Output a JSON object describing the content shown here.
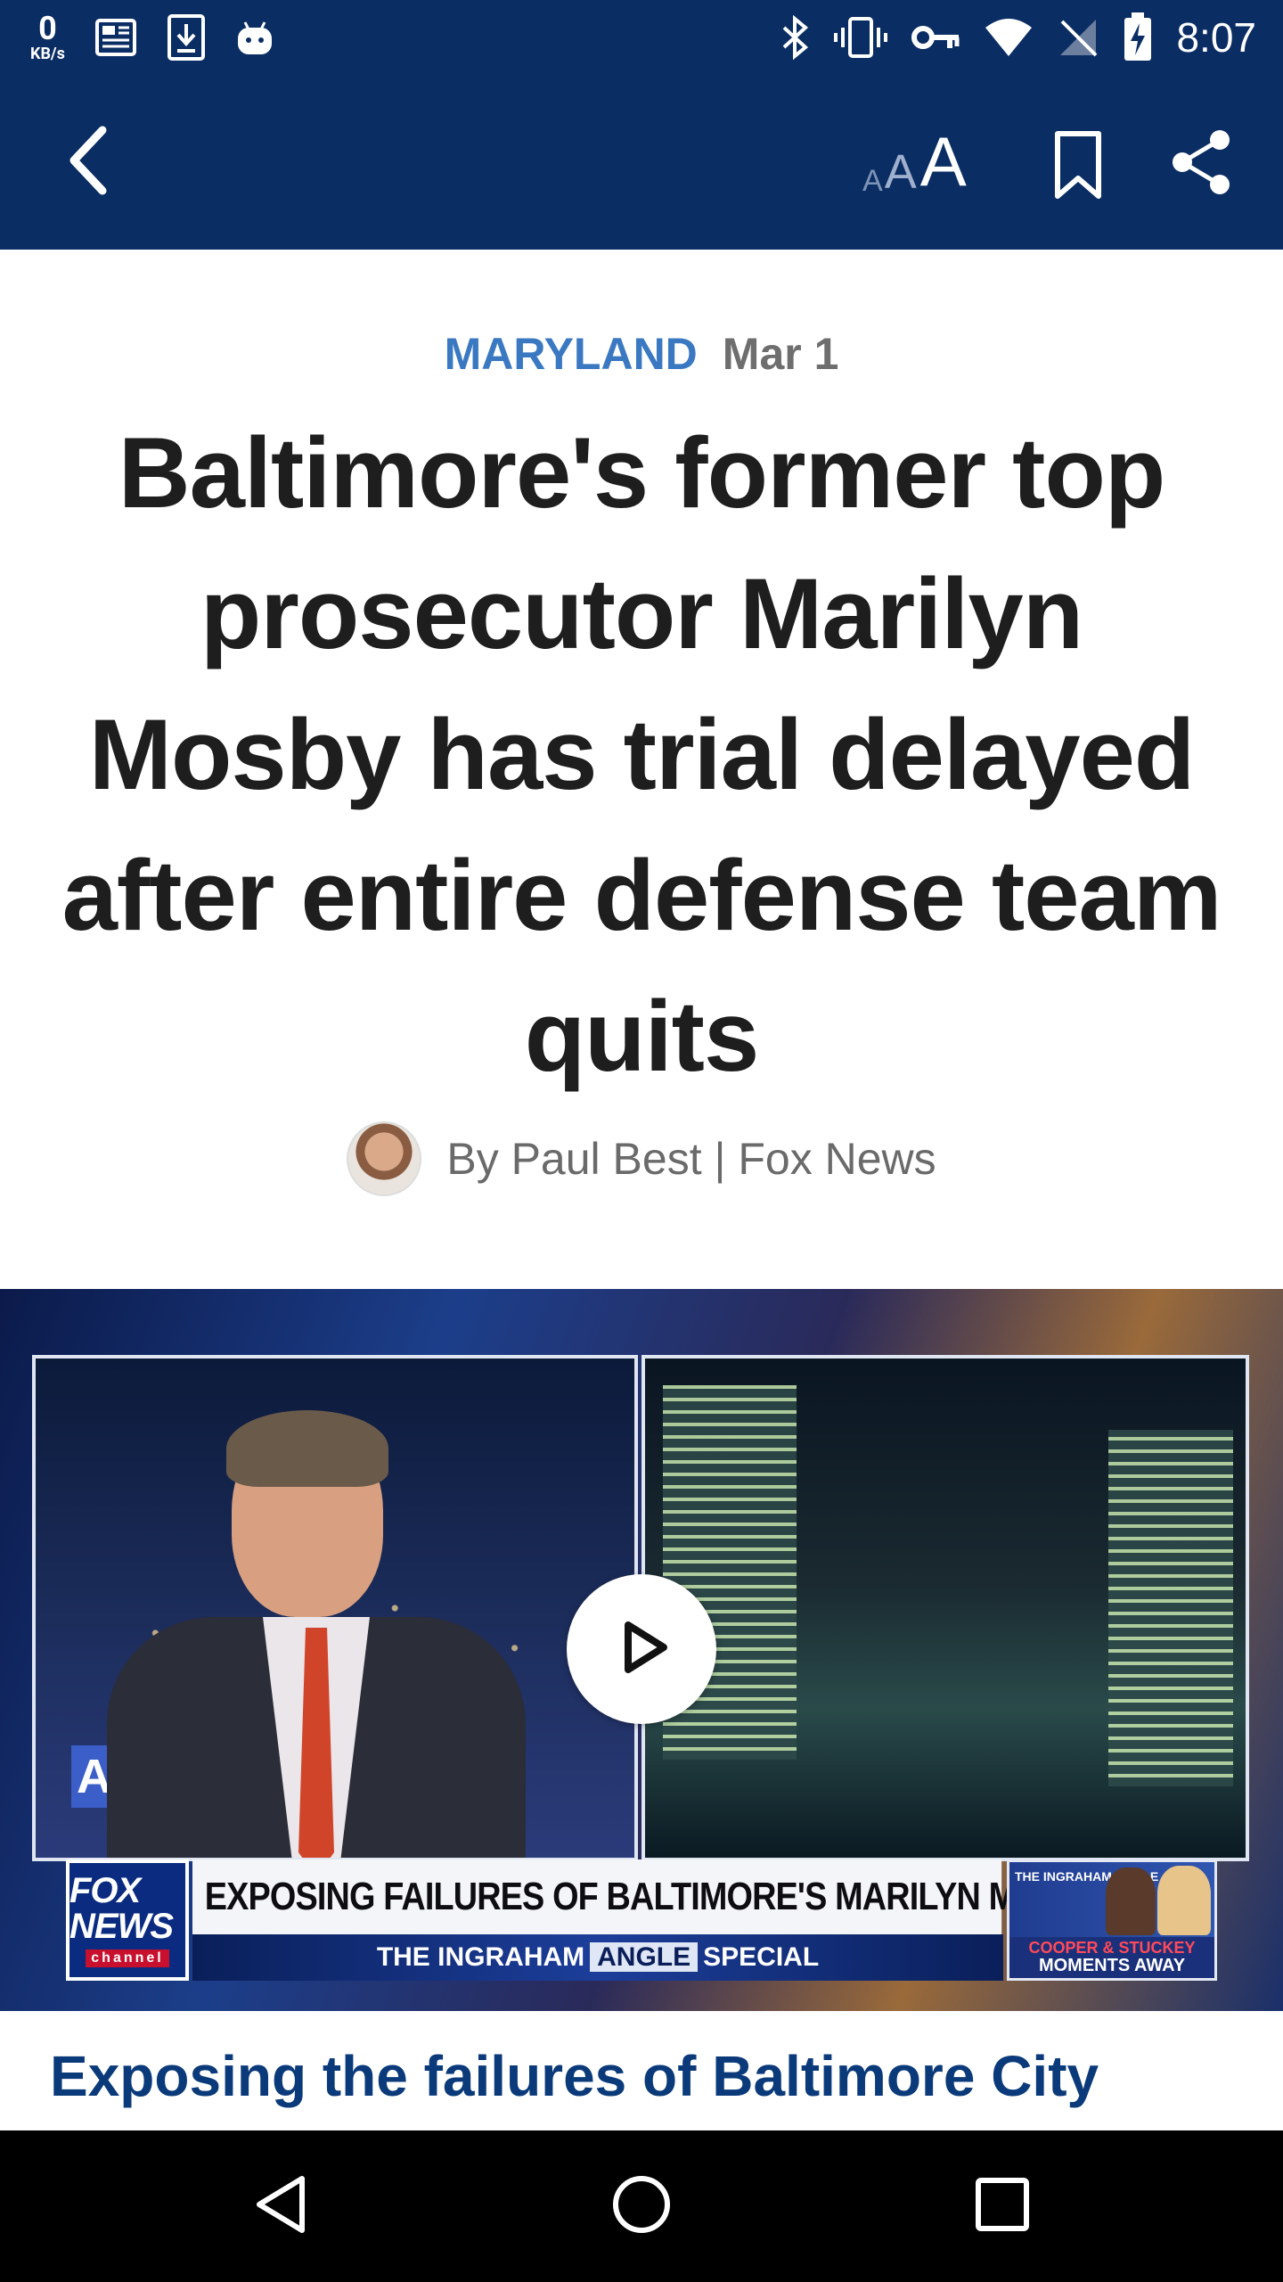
{
  "status_bar": {
    "net_speed_value": "0",
    "net_speed_unit": "KB/s",
    "time": "8:07",
    "left_icons": [
      "news-notification-icon",
      "download-notification-icon",
      "android-notification-icon"
    ],
    "right_icons": [
      "bluetooth-icon",
      "vibrate-icon",
      "vpn-key-icon",
      "wifi-icon",
      "no-sim-icon",
      "battery-charging-icon"
    ]
  },
  "app_bar": {
    "back_icon": "chevron-left-icon",
    "text_size_label_small": "A",
    "text_size_label_medium": "A",
    "text_size_label_large": "A",
    "bookmark_icon": "bookmark-icon",
    "share_icon": "share-icon"
  },
  "article": {
    "category": "MARYLAND",
    "date": "Mar 1",
    "headline": "Baltimore's former top prosecutor Marilyn Mosby has trial delayed after entire defense team quits",
    "byline": "By Paul Best | Fox News"
  },
  "video": {
    "left_chip_text": "AM",
    "network_logo_text": "FOX NEWS",
    "network_logo_sub": "channel",
    "chyron_headline": "EXPOSING FAILURES OF BALTIMORE'S MARILYN MOSBY",
    "chyron_sub_prefix": "THE INGRAHAM",
    "chyron_sub_highlight": "ANGLE",
    "chyron_sub_suffix": "SPECIAL",
    "promo_brand": "THE INGRAHAM ANGLE",
    "promo_line1": "COOPER & STUCKEY",
    "promo_line2": "MOMENTS AWAY",
    "play_icon": "play-icon",
    "caption": "Exposing the failures of Baltimore City"
  },
  "nav_bar": {
    "back_icon": "nav-back-icon",
    "home_icon": "nav-home-icon",
    "recents_icon": "nav-recents-icon"
  },
  "colors": {
    "app_bar_bg": "#0a2d63",
    "category": "#3a79c2",
    "caption": "#0a3a7a",
    "headline": "#1e1e1e"
  }
}
